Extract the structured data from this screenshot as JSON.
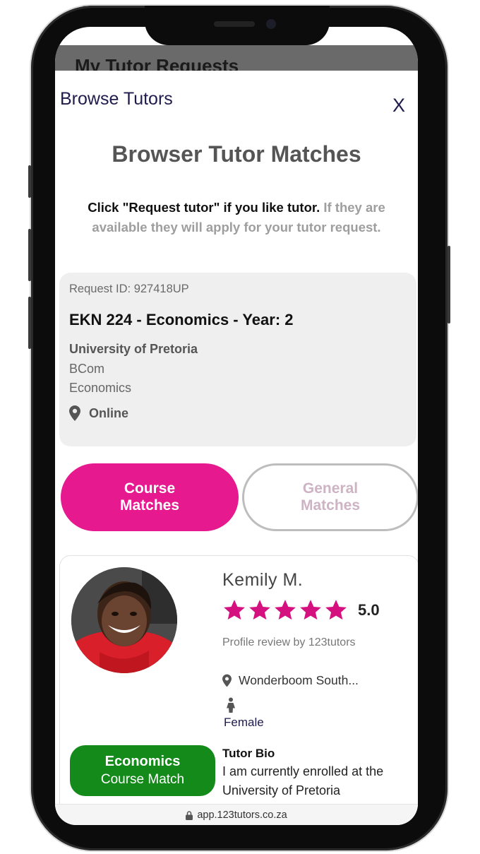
{
  "background_modal": {
    "title": "My Tutor Requests"
  },
  "modal": {
    "title": "Browse Tutors",
    "close_label": "X",
    "heading": "Browser Tutor Matches",
    "instruction_bold": "Click \"Request tutor\" if you like tutor.",
    "instruction_light": "If they are available they will apply for your tutor request."
  },
  "request": {
    "id_text": "Request ID: 927418UP",
    "course": "EKN 224 - Economics - Year: 2",
    "university": "University of Pretoria",
    "degree": "BCom",
    "subject": "Economics",
    "location": "Online"
  },
  "tabs": {
    "course_matches": "Course Matches",
    "general_matches": "General Matches",
    "active": "course_matches"
  },
  "tutor": {
    "name": "Kemily  M.",
    "rating": "5.0",
    "stars": 5,
    "review_note": "Profile review by 123tutors",
    "location": "Wonderboom South...",
    "gender": "Female",
    "match_subject": "Economics",
    "match_type": "Course Match",
    "bio_title": "Tutor Bio",
    "bio_text": "I am currently enrolled at the University of Pretoria"
  },
  "browser": {
    "url": "app.123tutors.co.za"
  },
  "colors": {
    "accent_pink": "#e6198f",
    "match_green": "#138a1a",
    "title_navy": "#1f1b4d"
  },
  "icons": {
    "close": "close-icon",
    "location": "map-pin-icon",
    "gender": "female-person-icon",
    "lock": "lock-icon",
    "star": "star-icon"
  }
}
